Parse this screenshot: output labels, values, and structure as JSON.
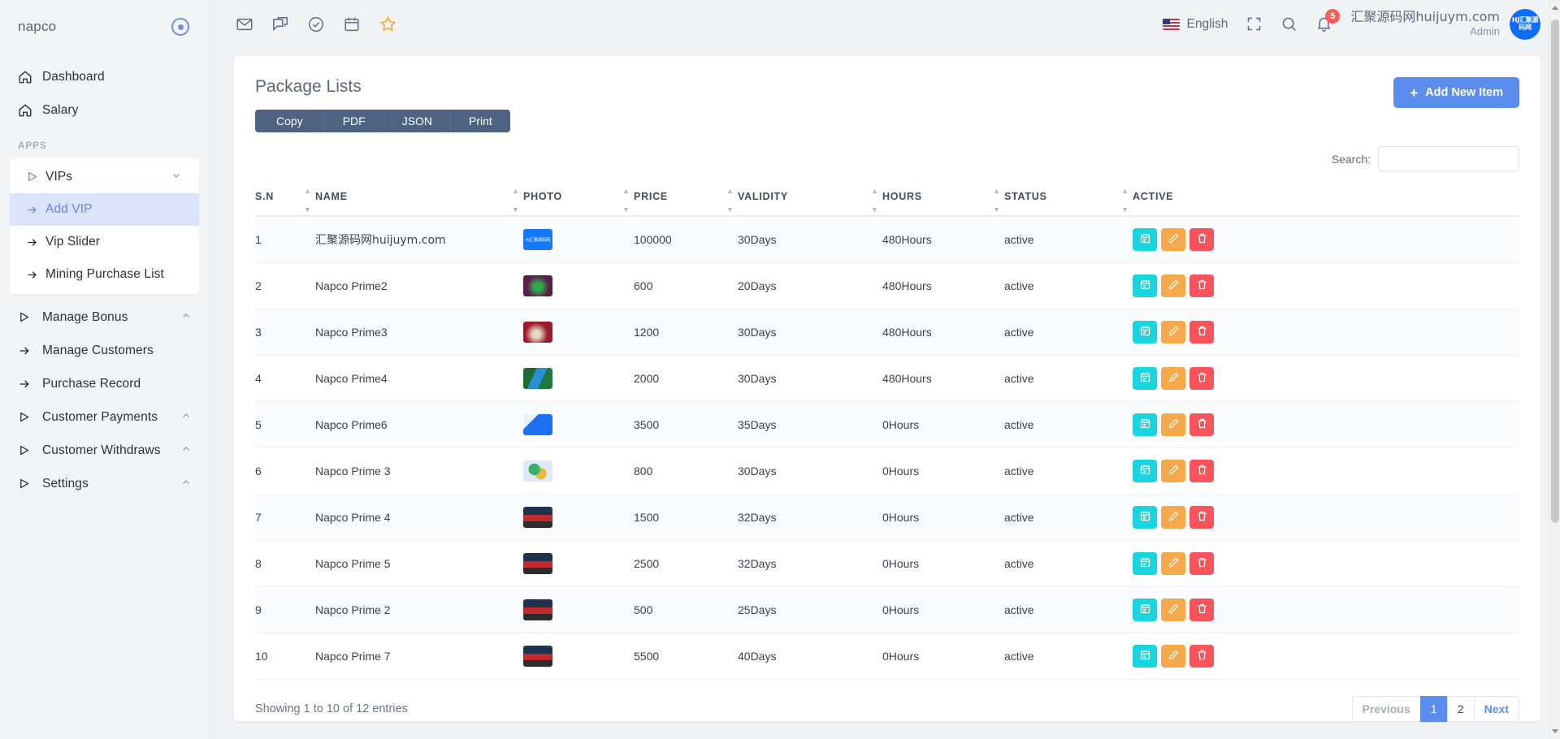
{
  "sidebar": {
    "brand": "napco",
    "section_label": "APPS",
    "top_items": [
      {
        "label": "Dashboard",
        "icon": "home-icon"
      },
      {
        "label": "Salary",
        "icon": "home-icon"
      }
    ],
    "group": {
      "label": "VIPs",
      "icon": "play-icon",
      "caret": "chevron-down-icon",
      "children": [
        {
          "label": "Add VIP",
          "icon": "arrow-right-icon",
          "active": true
        },
        {
          "label": "Vip Slider",
          "icon": "arrow-right-icon",
          "active": false
        },
        {
          "label": "Mining Purchase List",
          "icon": "arrow-right-icon",
          "active": false
        }
      ]
    },
    "bottom_items": [
      {
        "label": "Manage Bonus",
        "icon": "play-icon",
        "caret": "chevron-up-icon"
      },
      {
        "label": "Manage Customers",
        "icon": "arrow-right-icon",
        "caret": ""
      },
      {
        "label": "Purchase Record",
        "icon": "arrow-right-icon",
        "caret": ""
      },
      {
        "label": "Customer Payments",
        "icon": "play-icon",
        "caret": "chevron-up-icon"
      },
      {
        "label": "Customer Withdraws",
        "icon": "play-icon",
        "caret": "chevron-up-icon"
      },
      {
        "label": "Settings",
        "icon": "play-icon",
        "caret": "chevron-up-icon"
      }
    ]
  },
  "topbar": {
    "icons": [
      "mail-icon",
      "chat-icon",
      "check-circle-icon",
      "calendar-icon",
      "star-icon"
    ],
    "language": "English",
    "flag": "us-flag-icon",
    "fullscreen_icon": "fullscreen-icon",
    "search_icon": "search-icon",
    "notification_icon": "bell-icon",
    "notification_count": "5",
    "user_name": "汇聚源码网huijuym.com",
    "user_role": "Admin",
    "avatar_text": "HJ汇聚源码网"
  },
  "page": {
    "title": "Package Lists",
    "add_button": "Add New Item",
    "add_button_icon": "plus-icon",
    "export_buttons": [
      "Copy",
      "PDF",
      "JSON",
      "Print"
    ],
    "search_label": "Search:",
    "search_value": "",
    "search_placeholder": ""
  },
  "table": {
    "columns": [
      "S.N",
      "NAME",
      "PHOTO",
      "PRICE",
      "VALIDITY",
      "HOURS",
      "STATUS",
      "ACTIVE"
    ],
    "row_actions": [
      "calendar-icon",
      "edit-pencil-icon",
      "trash-icon"
    ],
    "rows": [
      {
        "sn": "1",
        "name": "汇聚源码网huijuym.com",
        "name_cn": true,
        "thumb": "t1",
        "price": "100000",
        "validity": "30Days",
        "hours": "480Hours",
        "status": "active"
      },
      {
        "sn": "2",
        "name": "Napco Prime2",
        "name_cn": false,
        "thumb": "t2",
        "price": "600",
        "validity": "20Days",
        "hours": "480Hours",
        "status": "active"
      },
      {
        "sn": "3",
        "name": "Napco Prime3",
        "name_cn": false,
        "thumb": "t3",
        "price": "1200",
        "validity": "30Days",
        "hours": "480Hours",
        "status": "active"
      },
      {
        "sn": "4",
        "name": "Napco Prime4",
        "name_cn": false,
        "thumb": "t4",
        "price": "2000",
        "validity": "30Days",
        "hours": "480Hours",
        "status": "active"
      },
      {
        "sn": "5",
        "name": "Napco Prime6",
        "name_cn": false,
        "thumb": "t5",
        "price": "3500",
        "validity": "35Days",
        "hours": "0Hours",
        "status": "active"
      },
      {
        "sn": "6",
        "name": "Napco Prime 3",
        "name_cn": false,
        "thumb": "t6",
        "price": "800",
        "validity": "30Days",
        "hours": "0Hours",
        "status": "active"
      },
      {
        "sn": "7",
        "name": "Napco Prime 4",
        "name_cn": false,
        "thumb": "t7",
        "price": "1500",
        "validity": "32Days",
        "hours": "0Hours",
        "status": "active"
      },
      {
        "sn": "8",
        "name": "Napco Prime 5",
        "name_cn": false,
        "thumb": "t7",
        "price": "2500",
        "validity": "32Days",
        "hours": "0Hours",
        "status": "active"
      },
      {
        "sn": "9",
        "name": "Napco Prime 2",
        "name_cn": false,
        "thumb": "t7",
        "price": "500",
        "validity": "25Days",
        "hours": "0Hours",
        "status": "active"
      },
      {
        "sn": "10",
        "name": "Napco Prime 7",
        "name_cn": false,
        "thumb": "t7",
        "price": "5500",
        "validity": "40Days",
        "hours": "0Hours",
        "status": "active"
      }
    ]
  },
  "footer": {
    "entries_text": "Showing 1 to 10 of 12 entries",
    "pagination": {
      "previous": "Previous",
      "pages": [
        "1",
        "2"
      ],
      "active_page": "1",
      "next": "Next"
    }
  },
  "colors": {
    "accent": "#5b8def",
    "export_bar": "#4e6380",
    "action_calendar": "#18d5e0",
    "action_edit": "#f5a94a",
    "action_delete": "#f9545b",
    "badge": "#ff5b5b",
    "sidebar_bg": "#f3f4f5",
    "active_sub_bg": "#dbe3fb"
  }
}
